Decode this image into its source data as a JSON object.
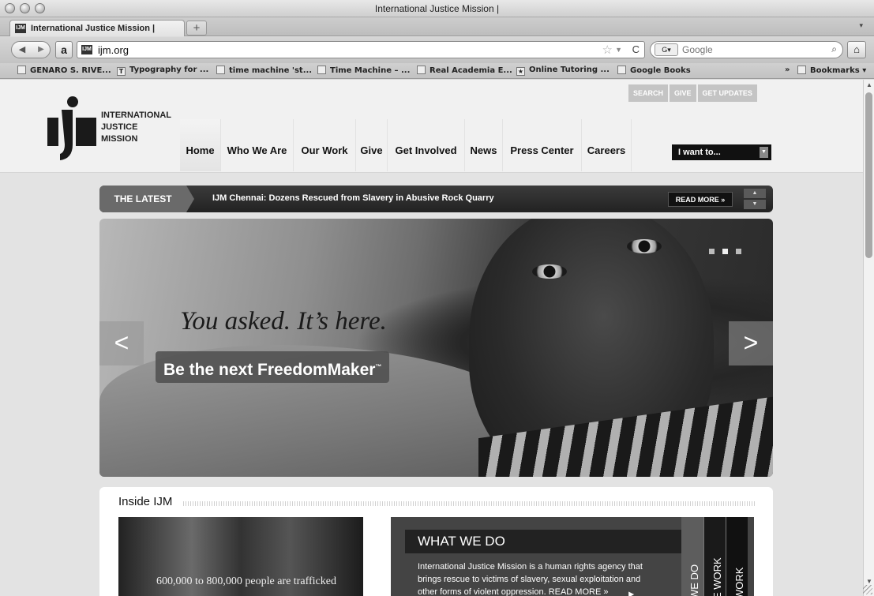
{
  "window": {
    "title": "International Justice Mission |"
  },
  "tabs": [
    {
      "label": "International Justice Mission |",
      "favicon": "IJM"
    }
  ],
  "navbar": {
    "url": "ijm.org",
    "amazon_label": "a",
    "search_placeholder": "Google",
    "search_engine": "G▾",
    "star_icon": "☆",
    "reload_icon": "C"
  },
  "bookmarks": [
    {
      "label": "GENARO S. RIVE...",
      "icon": ""
    },
    {
      "label": "Typography for ...",
      "icon": "T"
    },
    {
      "label": "time machine 'st...",
      "icon": ""
    },
    {
      "label": "Time Machine – ...",
      "icon": ""
    },
    {
      "label": "Real Academia E...",
      "icon": ""
    },
    {
      "label": "Online Tutoring ...",
      "icon": "★"
    },
    {
      "label": "Google Books",
      "icon": ""
    },
    {
      "label": "Bookmarks ▾",
      "icon": ""
    }
  ],
  "bookmarks_overflow": "»",
  "site": {
    "logo_lines": [
      "INTERNATIONAL",
      "JUSTICE",
      "MISSION"
    ],
    "util_nav": [
      "SEARCH",
      "GIVE",
      "GET UPDATES"
    ],
    "main_nav": [
      "Home",
      "Who We Are",
      "Our Work",
      "Give",
      "Get Involved",
      "News",
      "Press Center",
      "Careers"
    ],
    "iwant": "I want to...",
    "latest": {
      "tag": "THE LATEST",
      "headline": "IJM Chennai: Dozens Rescued from Slavery in Abusive Rock Quarry",
      "read_more": "READ MORE »"
    },
    "hero": {
      "tagline": "You asked. It’s here.",
      "cta": "Be the next FreedomMaker",
      "cta_mark": "™",
      "prev": "<",
      "next": ">"
    },
    "inside": {
      "title": "Inside IJM",
      "photo_caption": "600,000 to 800,000 people are trafficked",
      "what_we_do_title": "WHAT WE DO",
      "what_we_do_body": "International Justice Mission is a human rights agency that brings rescue to victims of slavery, sexual exploitation and other forms of violent oppression. READ MORE »",
      "vertical_tabs": [
        "WE DO",
        "E WORK",
        "WORK"
      ]
    }
  }
}
